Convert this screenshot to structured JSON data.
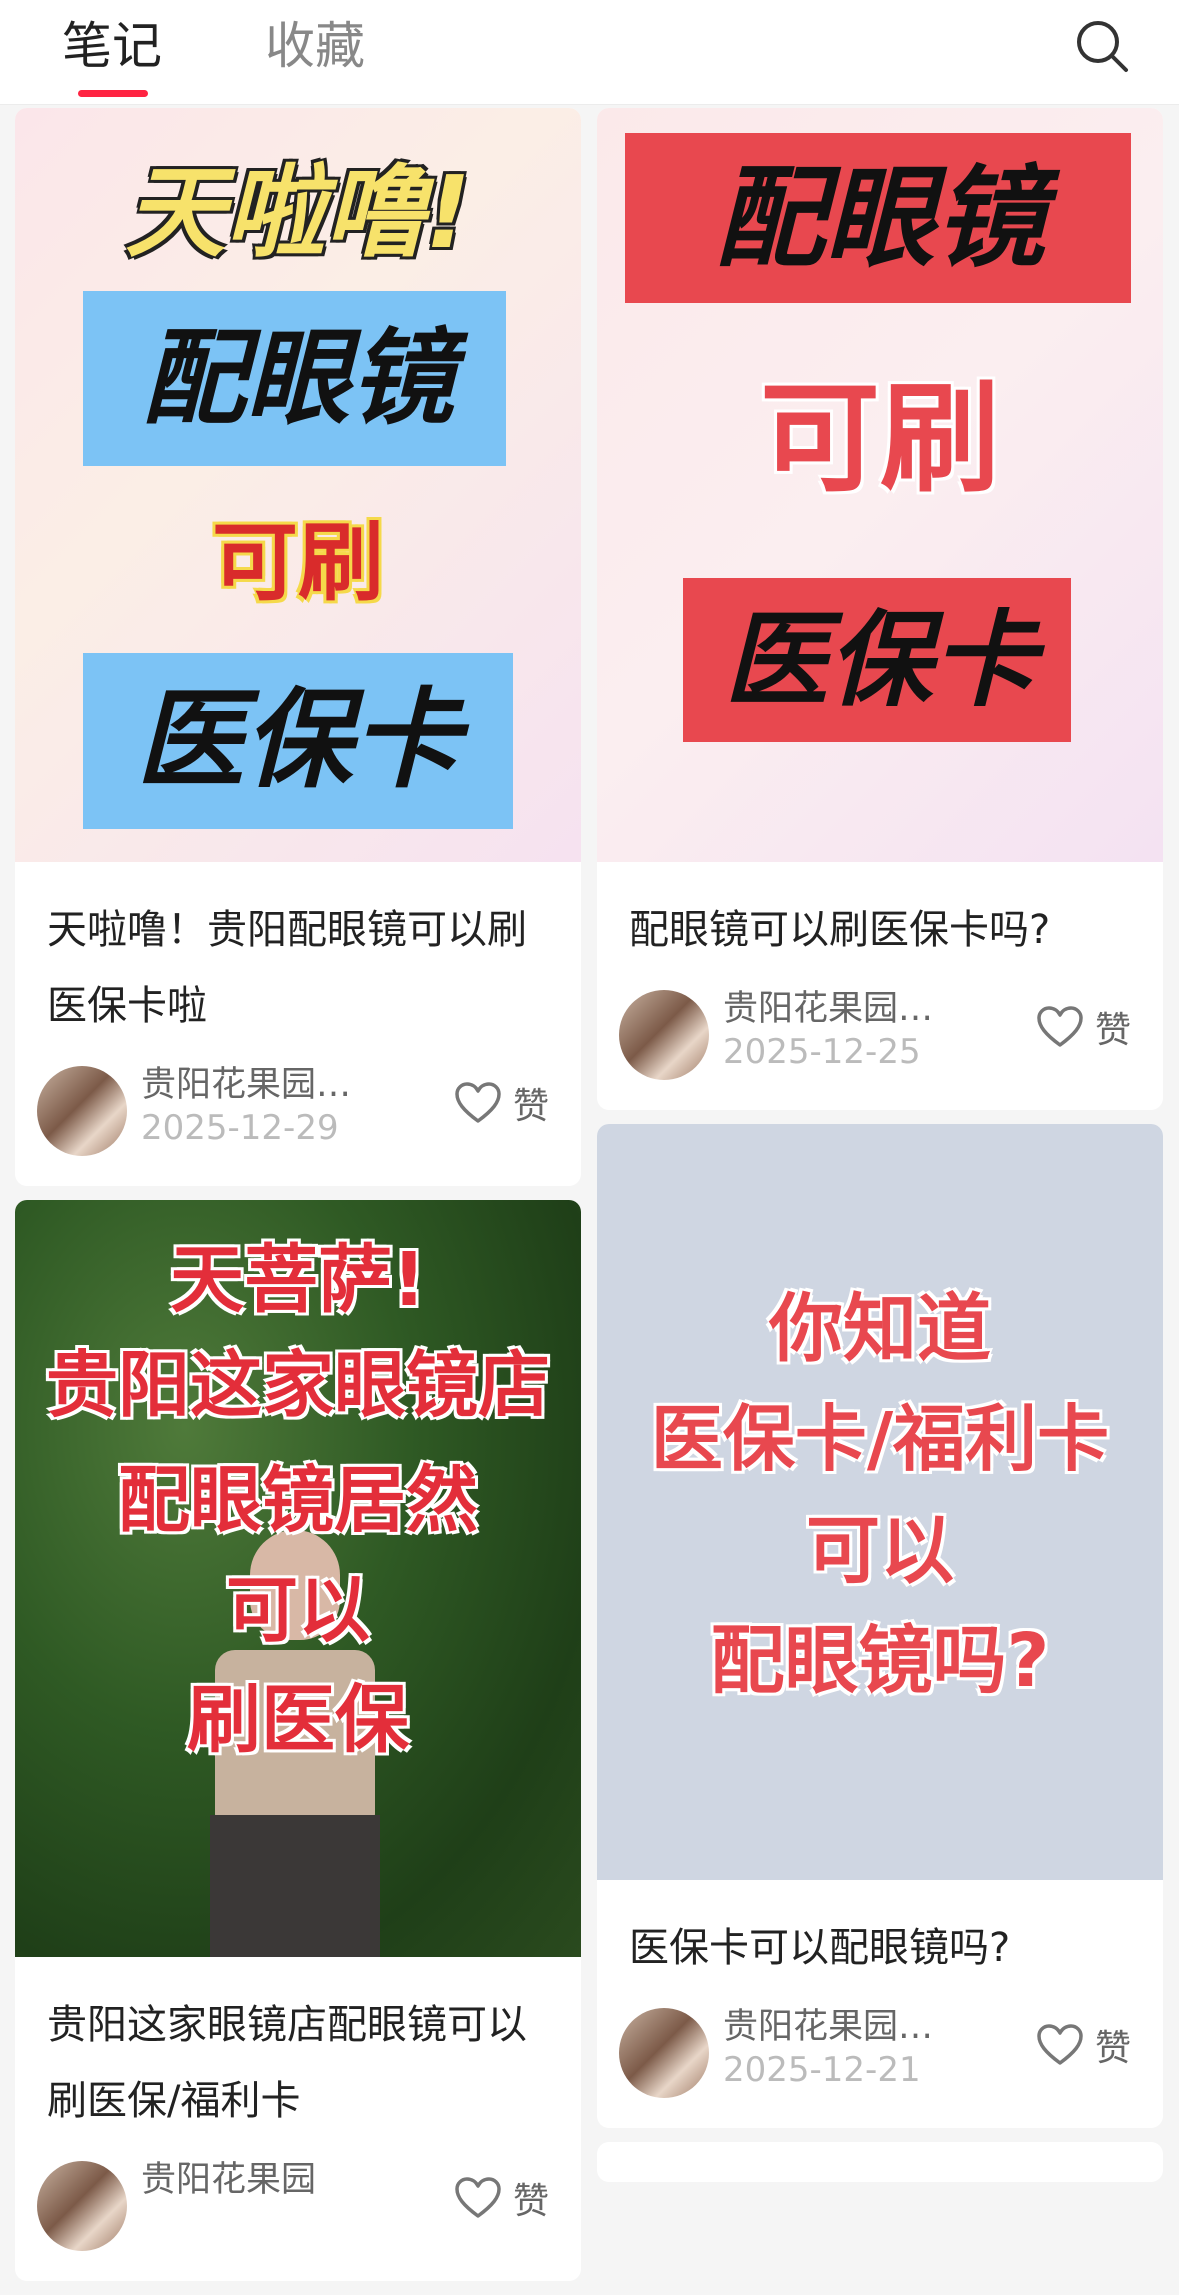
{
  "header": {
    "tab_notes": "笔记",
    "tab_favorites": "收藏",
    "search_icon": "search-icon"
  },
  "posts": [
    {
      "cover": {
        "line1": "天啦噜!",
        "line2": "配眼镜",
        "line3": "可刷",
        "line4": "医保卡"
      },
      "title": "天啦噜！贵阳配眼镜可以刷医保卡啦",
      "author": "贵阳花果园…",
      "date": "2025-12-29",
      "like_label": "赞"
    },
    {
      "cover": {
        "line1": "配眼镜",
        "line2": "可刷",
        "line3": "医保卡"
      },
      "title": "配眼镜可以刷医保卡吗?",
      "author": "贵阳花果园…",
      "date": "2025-12-25",
      "like_label": "赞"
    },
    {
      "cover": {
        "line1": "天菩萨!",
        "line2": "贵阳这家眼镜店",
        "line3": "配眼镜居然",
        "line4": "可以",
        "line5": "刷医保"
      },
      "title": "贵阳这家眼镜店配眼镜可以刷医保/福利卡",
      "author": "贵阳花果园",
      "date": "",
      "like_label": "赞"
    },
    {
      "cover": {
        "line1": "你知道",
        "line2": "医保卡/福利卡",
        "line3": "可以",
        "line4": "配眼镜吗?"
      },
      "title": "医保卡可以配眼镜吗?",
      "author": "贵阳花果园…",
      "date": "2025-12-21",
      "like_label": "赞"
    }
  ],
  "colors": {
    "accent": "#ff2442",
    "poster_red": "#e8484f",
    "poster_blue": "#7cc3f5",
    "poster_yellow": "#f7e26b"
  }
}
